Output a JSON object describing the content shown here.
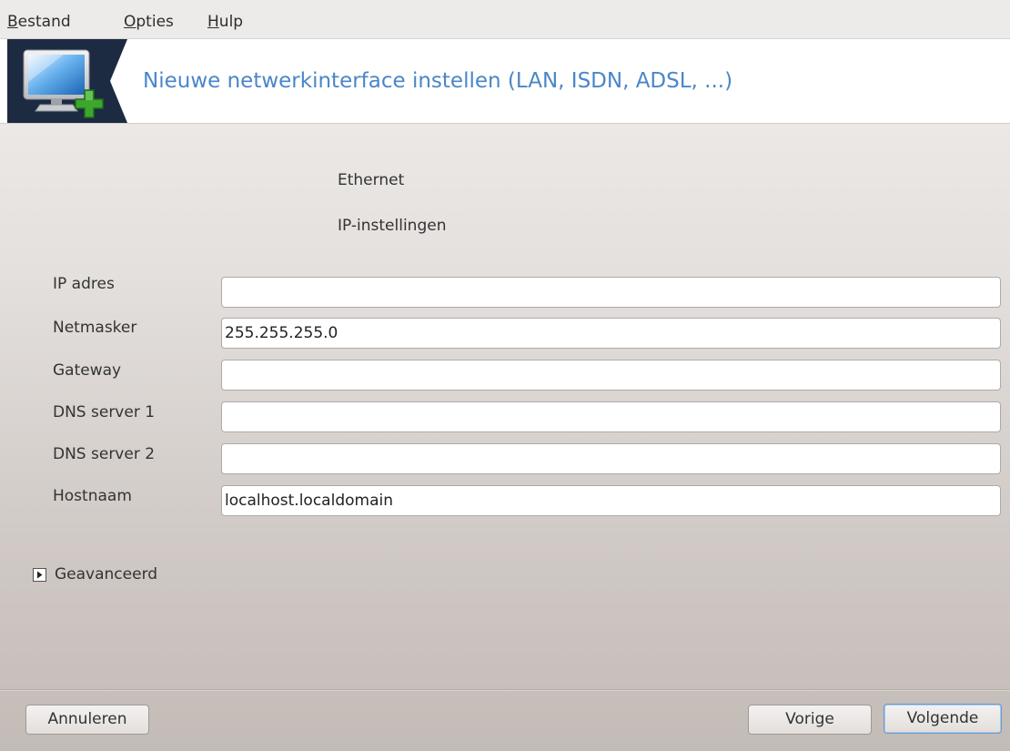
{
  "menubar": {
    "items": [
      {
        "first": "B",
        "rest": "estand"
      },
      {
        "first": "O",
        "rest": "pties"
      },
      {
        "first": "H",
        "rest": "ulp"
      }
    ]
  },
  "banner": {
    "icon": "network-monitor-add-icon",
    "title": "Nieuwe netwerkinterface instellen (LAN, ISDN, ADSL, ...)",
    "title_color": "#4a86c8",
    "icon_bg_color": "#1c2a42"
  },
  "headings": {
    "device": "Ethernet",
    "section": "IP-instellingen"
  },
  "form": {
    "fields": [
      {
        "label": "IP adres",
        "value": ""
      },
      {
        "label": "Netmasker",
        "value": "255.255.255.0"
      },
      {
        "label": "Gateway",
        "value": ""
      },
      {
        "label": "DNS server 1",
        "value": ""
      },
      {
        "label": "DNS server 2",
        "value": ""
      },
      {
        "label": "Hostnaam",
        "value": "localhost.localdomain"
      }
    ]
  },
  "advanced": {
    "label": "Geavanceerd",
    "icon": "expander-right-arrow-icon",
    "expanded": false
  },
  "buttons": {
    "cancel": "Annuleren",
    "previous": "Vorige",
    "next": "Volgende"
  }
}
